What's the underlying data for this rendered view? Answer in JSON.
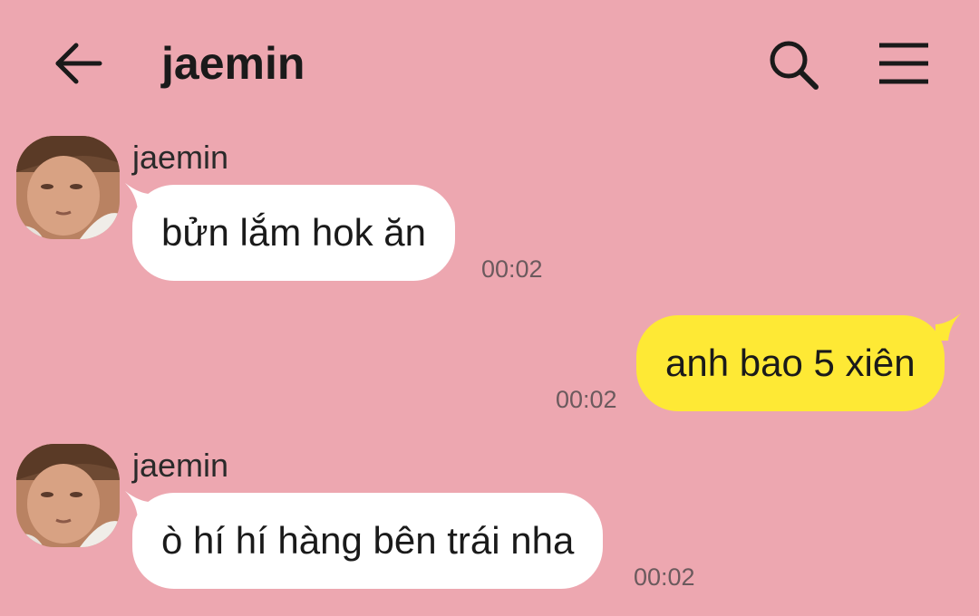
{
  "header": {
    "title": "jaemin",
    "back_icon": "arrow-left-icon",
    "search_icon": "search-icon",
    "menu_icon": "hamburger-menu-icon"
  },
  "colors": {
    "background": "#eda7b0",
    "incoming_bubble": "#ffffff",
    "outgoing_bubble": "#fee935"
  },
  "messages": [
    {
      "direction": "incoming",
      "sender": "jaemin",
      "text": "bửn lắm hok ăn",
      "time": "00:02"
    },
    {
      "direction": "outgoing",
      "text": "anh bao 5 xiên",
      "time": "00:02"
    },
    {
      "direction": "incoming",
      "sender": "jaemin",
      "text": "ò hí hí hàng bên trái nha",
      "time": "00:02"
    }
  ]
}
